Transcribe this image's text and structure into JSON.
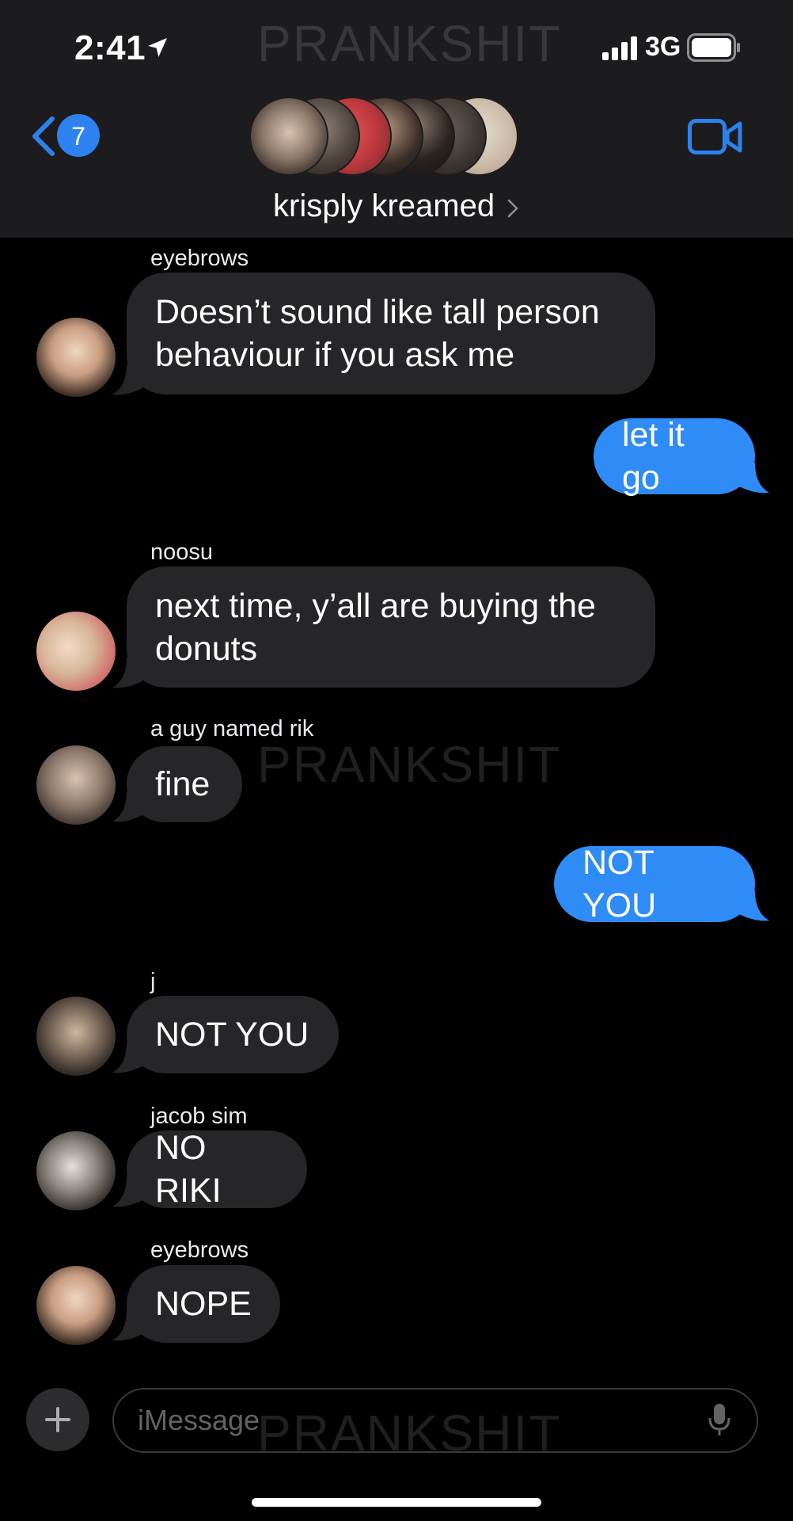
{
  "status_bar": {
    "time": "2:41",
    "network": "3G"
  },
  "header": {
    "back_badge": "7",
    "group_name": "krisply kreamed"
  },
  "watermark": "PRANKSHIT",
  "messages": [
    {
      "sender": "eyebrows",
      "lines": [
        "Doesn’t sound like tall person",
        "behaviour if you ask me"
      ],
      "direction": "incoming"
    },
    {
      "text": "let it go",
      "direction": "outgoing"
    },
    {
      "sender": "noosu",
      "lines": [
        "next time, y’all are buying the",
        "donuts"
      ],
      "direction": "incoming"
    },
    {
      "sender": "a guy named rik",
      "text": "fine",
      "direction": "incoming"
    },
    {
      "text": "NOT YOU",
      "direction": "outgoing"
    },
    {
      "sender": "j",
      "text": "NOT YOU",
      "direction": "incoming"
    },
    {
      "sender": "jacob sim",
      "text": "NO RIKI",
      "direction": "incoming"
    },
    {
      "sender": "eyebrows",
      "text": "NOPE",
      "direction": "incoming"
    }
  ],
  "input": {
    "placeholder": "iMessage"
  },
  "colors": {
    "outgoing_bubble": "#2f8bf6",
    "incoming_bubble": "#262629",
    "accent": "#2e82f0",
    "header_bg": "#1c1c1e"
  },
  "icons": [
    "location-arrow-icon",
    "signal-bars-icon",
    "battery-icon",
    "back-chevron-icon",
    "video-camera-icon",
    "chevron-right-icon",
    "plus-icon",
    "microphone-icon"
  ]
}
